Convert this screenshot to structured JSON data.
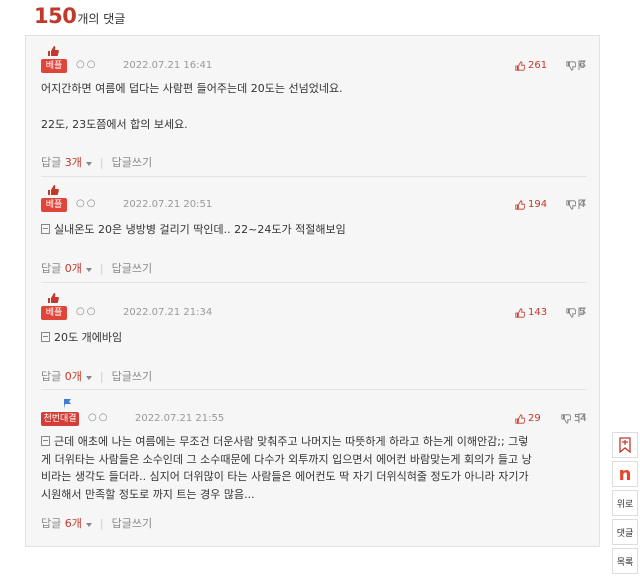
{
  "header": {
    "count": "150",
    "suffix": "개의 댓글"
  },
  "comments": [
    {
      "badge": "베플",
      "dots": "○○",
      "date": "2022.07.21 16:41",
      "up": "261",
      "down": "6",
      "lines": [
        "어지간하면 여름에 덥다는 사람편 들어주는데 20도는 선넘었네요.",
        "",
        "22도, 23도쯤에서 합의 보세요."
      ],
      "reply_label": "답글",
      "reply_count": "3개",
      "write_label": "답글쓰기"
    },
    {
      "badge": "베플",
      "dots": "○○",
      "date": "2022.07.21 20:51",
      "up": "194",
      "down": "4",
      "lines": [
        "실내온도 20은 냉방병 걸리기 딱인데.. 22~24도가 적절해보임"
      ],
      "reply_label": "답글",
      "reply_count": "0개",
      "write_label": "답글쓰기"
    },
    {
      "badge": "베플",
      "dots": "○○",
      "date": "2022.07.21 21:34",
      "up": "143",
      "down": "5",
      "lines": [
        "20도 개에바임"
      ],
      "reply_label": "답글",
      "reply_count": "0개",
      "write_label": "답글쓰기"
    },
    {
      "badge": "천번대결",
      "dots": "○○",
      "date": "2022.07.21 21:55",
      "up": "29",
      "down": "54",
      "lines": [
        "근데 애초에 나는 여름에는 무조건 더운사람 맞춰주고 나머지는 따뜻하게 하라고 하는게 이해안감;; 그렇",
        "게 더위타는 사람들은 소수인데 그 소수때문에 다수가 외투까지 입으면서 에어컨 바람맞는게 회의가 들고 낭",
        "비라는 생각도 들더라.. 심지어 더위많이 타는 사람들은 에어컨도 딱 자기 더위식혀줄 정도가 아니라 자기가",
        "시원해서 만족할 정도로 까지 트는 경우 많음..."
      ],
      "reply_label": "답글",
      "reply_count": "6개",
      "write_label": "답글쓰기"
    }
  ],
  "side": {
    "top": "위로",
    "comments": "댓글",
    "list": "목록"
  },
  "colors": {
    "accent": "#c0392b",
    "badge": "#e0453a",
    "brand_n": "#e8432c"
  }
}
